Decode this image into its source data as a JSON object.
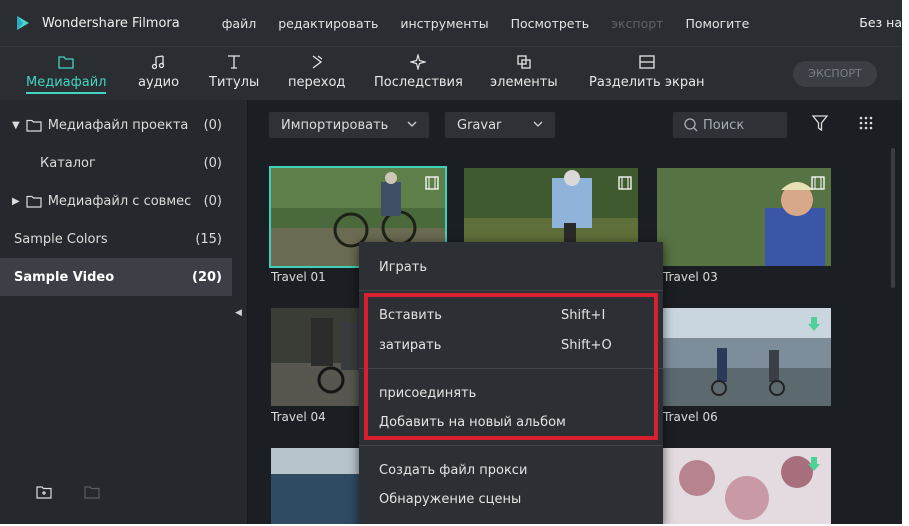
{
  "app": {
    "name": "Wondershare Filmora",
    "title_right": "Без на"
  },
  "menu": [
    "файл",
    "редактировать",
    "инструменты",
    "Посмотреть",
    "экспорт",
    "Помогите"
  ],
  "toolbar": {
    "tabs": [
      {
        "label": "Медиафайл",
        "icon": "folder-icon"
      },
      {
        "label": "аудио",
        "icon": "music-note-icon"
      },
      {
        "label": "Титулы",
        "icon": "text-t-icon"
      },
      {
        "label": "переход",
        "icon": "transition-icon"
      },
      {
        "label": "Последствия",
        "icon": "effects-sparkle-icon"
      },
      {
        "label": "элементы",
        "icon": "elements-icon"
      },
      {
        "label": "Разделить экран",
        "icon": "split-screen-icon"
      }
    ],
    "active_tab": "Медиафайл",
    "export_label": "ЭКСПОРТ"
  },
  "sidebar": {
    "items": [
      {
        "label": "Медиафайл проекта",
        "count": "(0)"
      },
      {
        "label": "Каталог",
        "count": "(0)"
      },
      {
        "label": "Медиафайл с совмес",
        "count": "(0)"
      },
      {
        "label": "Sample Colors",
        "count": "(15)"
      },
      {
        "label": "Sample Video",
        "count": "(20)"
      }
    ],
    "selected": "Sample Video"
  },
  "content": {
    "import_label": "Импортировать",
    "record_label": "Gravar",
    "search_placeholder": "Поиск",
    "thumbnails": [
      {
        "label": "Travel 01"
      },
      {
        "label": ""
      },
      {
        "label": "Travel 03"
      },
      {
        "label": "Travel 04"
      },
      {
        "label": ""
      },
      {
        "label": "Travel 06"
      }
    ]
  },
  "context_menu": {
    "play": "Играть",
    "insert": "Вставить",
    "insert_shortcut": "Shift+I",
    "overwrite": "затирать",
    "overwrite_shortcut": "Shift+O",
    "append": "присоединять",
    "add_to_album": "Добавить на новый альбом",
    "create_proxy": "Создать файл прокси",
    "scene_detect": "Обнаружение сцены"
  },
  "colors": {
    "accent": "#42d6c2",
    "highlight_box": "#d9202f",
    "background": "#1b1e22"
  }
}
